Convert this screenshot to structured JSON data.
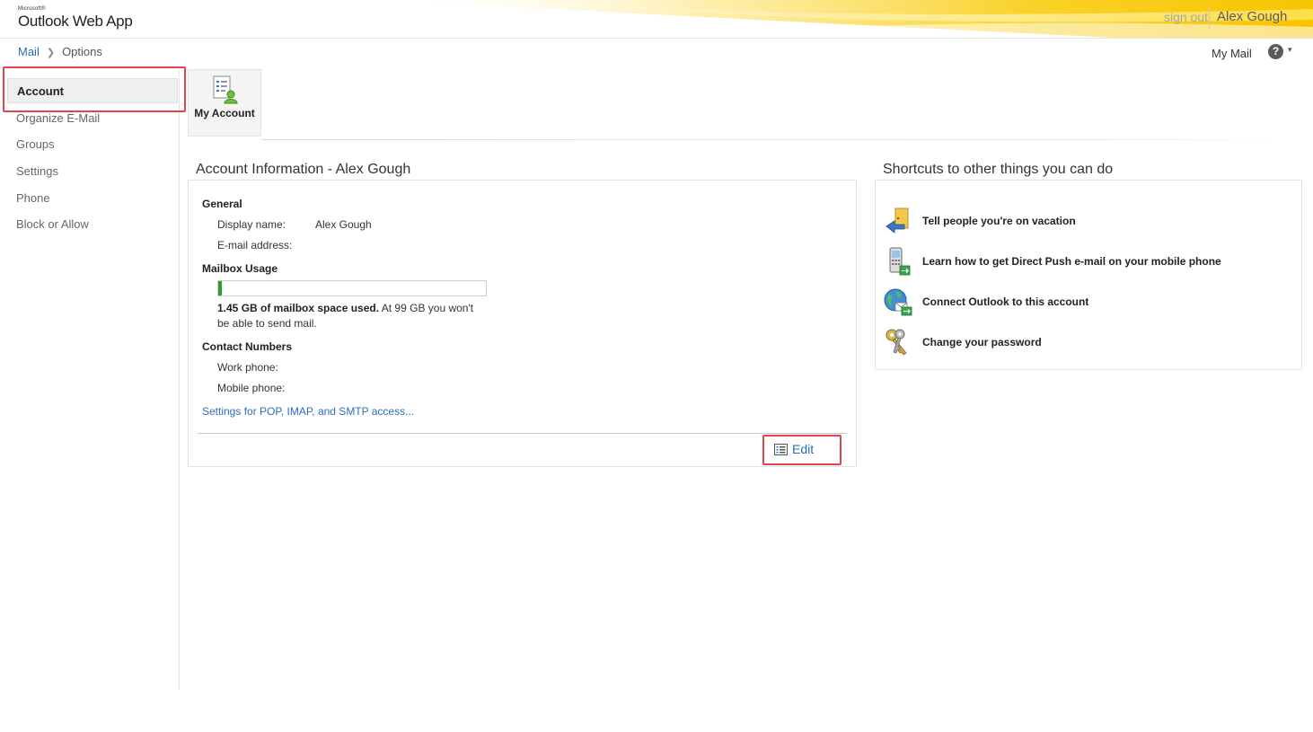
{
  "app": {
    "brand_small": "Microsoft®",
    "brand_name": "Outlook Web App",
    "sign_out": "sign out",
    "user_name": "Alex Gough"
  },
  "breadcrumb": {
    "mail": "Mail",
    "current": "Options"
  },
  "top_right": {
    "my_mail": "My Mail",
    "help_glyph": "?",
    "caret_glyph": "▾"
  },
  "sidebar": {
    "items": [
      {
        "label": "Account",
        "active": true
      },
      {
        "label": "Organize E-Mail",
        "active": false
      },
      {
        "label": "Groups",
        "active": false
      },
      {
        "label": "Settings",
        "active": false
      },
      {
        "label": "Phone",
        "active": false
      },
      {
        "label": "Block or Allow",
        "active": false
      }
    ]
  },
  "tab": {
    "label": "My Account",
    "icon": "account-settings-icon"
  },
  "account_info": {
    "title": "Account Information - Alex Gough",
    "general_heading": "General",
    "display_name_label": "Display name:",
    "display_name_value": "Alex Gough",
    "email_label": "E-mail address:",
    "email_value": "",
    "mailbox_heading": "Mailbox Usage",
    "usage_fraction": 0.0146,
    "usage_bold": "1.45 GB of mailbox space used.",
    "usage_rest": " At 99 GB you won't be able to send mail.",
    "contact_heading": "Contact Numbers",
    "work_phone_label": "Work phone:",
    "mobile_phone_label": "Mobile phone:",
    "pop_link": "Settings for POP, IMAP, and SMTP access...",
    "edit_label": "Edit"
  },
  "shortcuts": {
    "title": "Shortcuts to other things you can do",
    "items": [
      {
        "label": "Tell people you're on vacation",
        "icon": "vacation-door-icon"
      },
      {
        "label": "Learn how to get Direct Push e-mail on your mobile phone",
        "icon": "mobile-phone-icon"
      },
      {
        "label": "Connect Outlook to this account",
        "icon": "globe-connect-icon"
      },
      {
        "label": "Change your password",
        "icon": "keys-icon"
      }
    ]
  },
  "colors": {
    "accent_link": "#2a6ebb",
    "highlight_red": "#e0454d",
    "usage_green": "#2e9e2e",
    "header_yellow": "#f7c400"
  }
}
